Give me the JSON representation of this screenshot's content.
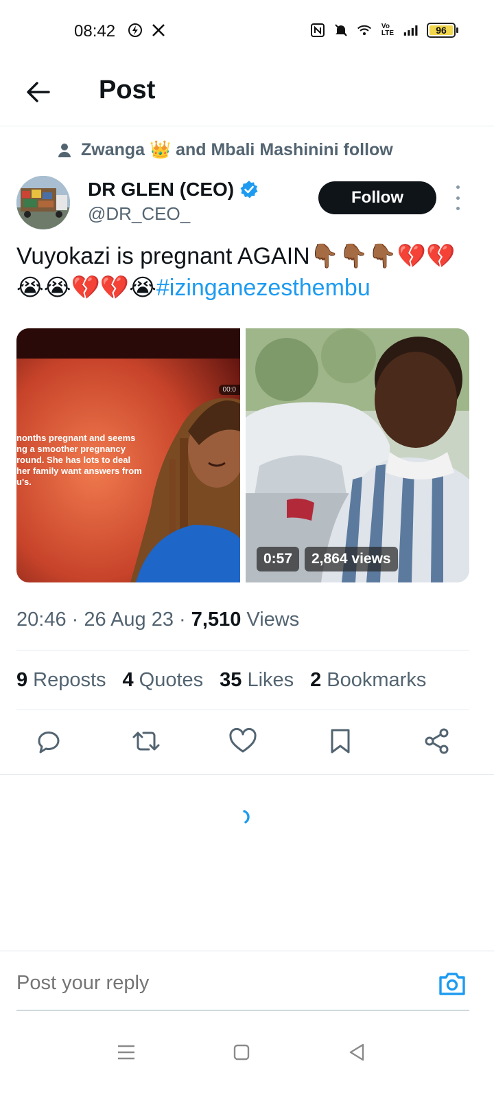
{
  "status_bar": {
    "time": "08:42",
    "battery": "96",
    "icons": [
      "lightning-icon",
      "x-logo-icon",
      "nfc-icon",
      "mute-icon",
      "wifi-icon",
      "volte-icon",
      "signal-icon",
      "battery-icon"
    ],
    "battery_color": "#f2d64b"
  },
  "header": {
    "title": "Post"
  },
  "social_context": {
    "text": "Zwanga 👑 and Mbali Mashinini follow"
  },
  "author": {
    "name": "DR GLEN (CEO)",
    "handle": "@DR_CEO_",
    "verified": true,
    "follow_label": "Follow"
  },
  "tweet": {
    "text": "Vuyokazi is pregnant AGAIN👇🏾👇🏾👇🏾💔💔😭😭💔💔😭",
    "hashtag": "#izinganezesthembu"
  },
  "media": {
    "left_overlay": [
      "nonths pregnant and seems",
      "ng a smoother pregnancy",
      "round. She has lots to deal",
      "her family want answers from",
      "u's."
    ],
    "left_timer": "00:0",
    "video_duration": "0:57",
    "video_views": "2,864 views"
  },
  "meta": {
    "time": "20:46",
    "sep1": " · ",
    "date": "26 Aug 23",
    "sep2": " · ",
    "views_count": "7,510",
    "views_label": "Views"
  },
  "stats": {
    "reposts_count": "9",
    "reposts_label": "Reposts",
    "quotes_count": "4",
    "quotes_label": "Quotes",
    "likes_count": "35",
    "likes_label": "Likes",
    "bookmarks_count": "2",
    "bookmarks_label": "Bookmarks"
  },
  "actions": [
    "reply-icon",
    "repost-icon",
    "like-icon",
    "bookmark-icon",
    "share-icon"
  ],
  "reply": {
    "placeholder": "Post your reply"
  },
  "colors": {
    "accent": "#1d9bf0",
    "text_primary": "#0f1419",
    "text_secondary": "#536471"
  }
}
